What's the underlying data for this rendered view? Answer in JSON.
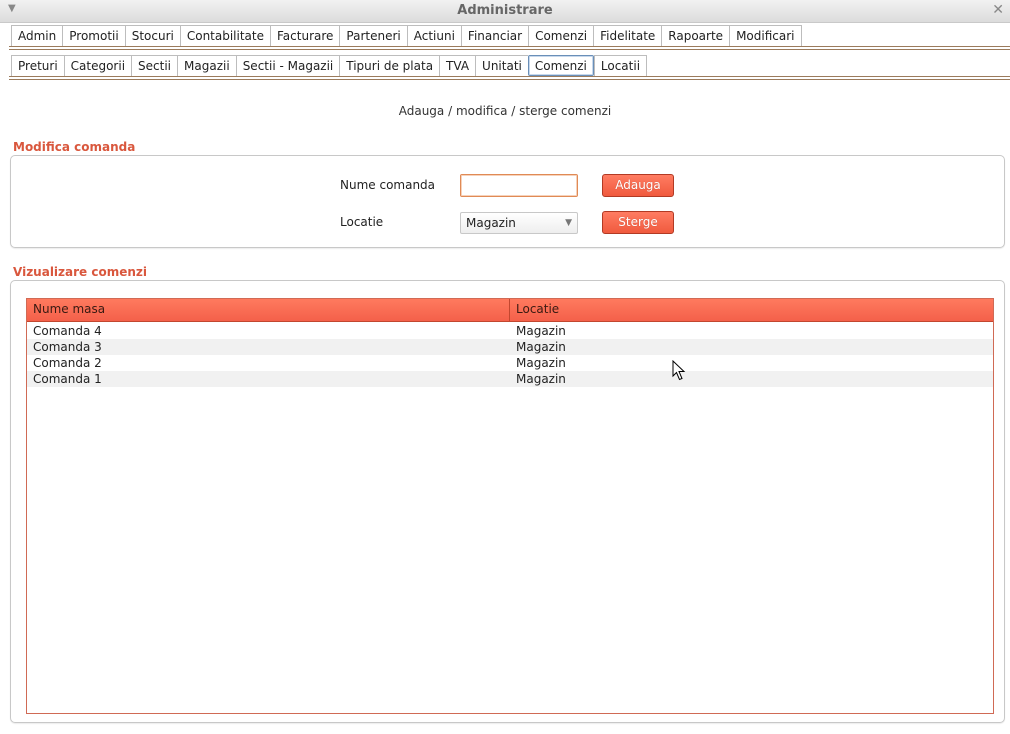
{
  "window": {
    "title": "Administrare"
  },
  "top_tabs": [
    {
      "label": "Admin"
    },
    {
      "label": "Promotii"
    },
    {
      "label": "Stocuri"
    },
    {
      "label": "Contabilitate"
    },
    {
      "label": "Facturare"
    },
    {
      "label": "Parteneri"
    },
    {
      "label": "Actiuni"
    },
    {
      "label": "Financiar"
    },
    {
      "label": "Comenzi"
    },
    {
      "label": "Fidelitate"
    },
    {
      "label": "Rapoarte"
    },
    {
      "label": "Modificari",
      "active": true
    }
  ],
  "sub_tabs": [
    {
      "label": "Preturi"
    },
    {
      "label": "Categorii"
    },
    {
      "label": "Sectii"
    },
    {
      "label": "Magazii"
    },
    {
      "label": "Sectii - Magazii"
    },
    {
      "label": "Tipuri de plata"
    },
    {
      "label": "TVA"
    },
    {
      "label": "Unitati"
    },
    {
      "label": "Comenzi",
      "active": true
    },
    {
      "label": "Locatii"
    }
  ],
  "page": {
    "heading": "Adauga / modifica / sterge comenzi"
  },
  "edit_section": {
    "title": "Modifica comanda",
    "name_label": "Nume comanda",
    "name_value": "",
    "location_label": "Locatie",
    "location_value": "Magazin",
    "add_button": "Adauga",
    "delete_button": "Sterge"
  },
  "view_section": {
    "title": "Vizualizare comenzi",
    "columns": [
      "Nume masa",
      "Locatie"
    ],
    "rows": [
      [
        "Comanda 4",
        "Magazin"
      ],
      [
        "Comanda 3",
        "Magazin"
      ],
      [
        "Comanda 2",
        "Magazin"
      ],
      [
        "Comanda 1",
        "Magazin"
      ]
    ]
  },
  "colors": {
    "accent": "#f05a3e",
    "section_title": "#d9573d",
    "tab_rule": "#9b7b5c"
  }
}
